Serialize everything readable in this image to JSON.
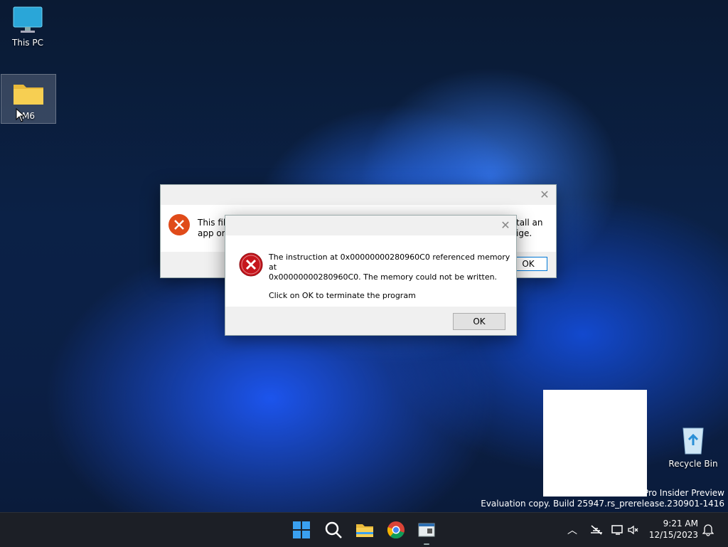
{
  "desktop": {
    "icons": [
      {
        "label": "This PC",
        "icon": "monitor-icon"
      },
      {
        "label": "M6",
        "icon": "folder-icon"
      },
      {
        "label": "Recycle Bin",
        "icon": "recycle-bin-icon"
      }
    ]
  },
  "back_dialog": {
    "text_left_line1": "This fil",
    "text_left_line2": "app or,",
    "text_right_line1": "tall an",
    "text_right_line2": "ige.",
    "ok_label": "OK"
  },
  "front_dialog": {
    "message_line1": "The instruction at 0x00000000280960C0 referenced memory at",
    "message_line2": "0x00000000280960C0. The memory could not be written.",
    "message_line3": "Click on OK to terminate the program",
    "ok_label": "OK"
  },
  "watermark": {
    "line1": "1 Pro Insider Preview",
    "line2": "Evaluation copy. Build 25947.rs_prerelease.230901-1416"
  },
  "taskbar": {
    "apps": [
      "start-icon",
      "search-icon",
      "file-explorer-icon",
      "chrome-icon",
      "app-window-icon"
    ],
    "time": "9:21 AM",
    "date": "12/15/2023"
  },
  "colors": {
    "accent": "#0078d7",
    "error_red": "#e04b1a"
  }
}
